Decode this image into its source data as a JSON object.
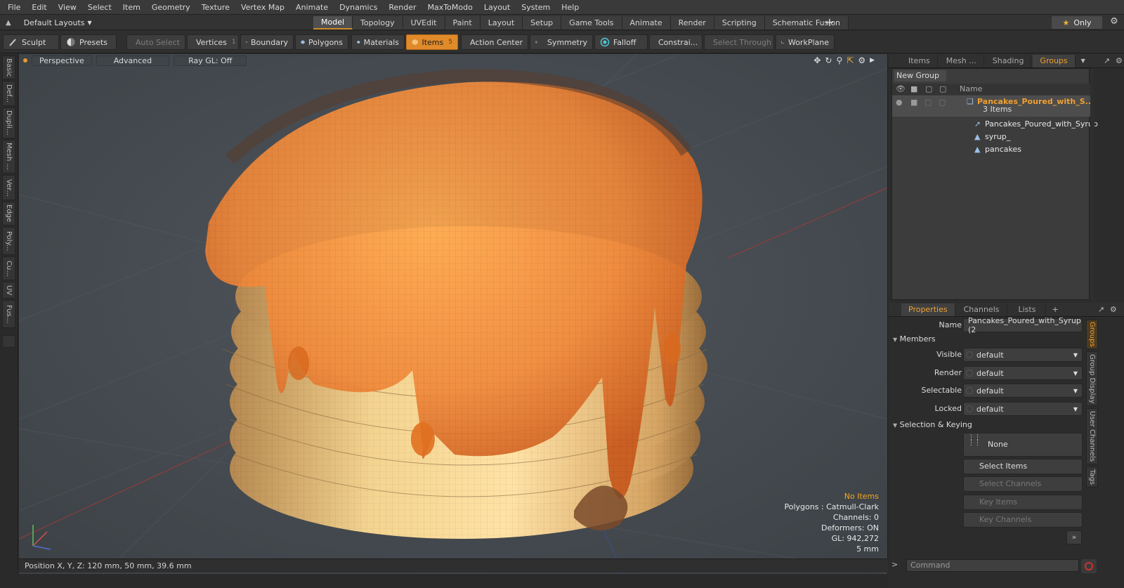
{
  "menu": [
    "File",
    "Edit",
    "View",
    "Select",
    "Item",
    "Geometry",
    "Texture",
    "Vertex Map",
    "Animate",
    "Dynamics",
    "Render",
    "MaxToModo",
    "Layout",
    "System",
    "Help"
  ],
  "layout": {
    "label": "Default Layouts"
  },
  "mode_tabs": [
    "Model",
    "Topology",
    "UVEdit",
    "Paint",
    "Layout",
    "Setup",
    "Game Tools",
    "Animate",
    "Render",
    "Scripting",
    "Schematic Fusion"
  ],
  "only_label": "Only",
  "toolbar": {
    "sculpt": "Sculpt",
    "presets": "Presets",
    "auto_select": "Auto Select",
    "vertices": "Vertices",
    "vertices_count": "1",
    "boundary": "Boundary",
    "polygons": "Polygons",
    "materials": "Materials",
    "items": "Items",
    "items_count": "5",
    "action_center": "Action Center",
    "symmetry": "Symmetry",
    "falloff": "Falloff",
    "constraints": "Constrai...",
    "select_through": "Select Through",
    "workplane": "WorkPlane"
  },
  "left_tabs": [
    "Basic",
    "Def...",
    "Dupli...",
    "Mesh ...",
    "Ver...",
    "Edge",
    "Poly...",
    "Cu...",
    "UV",
    "Fus..."
  ],
  "viewport": {
    "view": "Perspective",
    "shading": "Advanced",
    "raygl": "Ray GL: Off",
    "info": {
      "selection": "No Items",
      "polygons": "Polygons : Catmull-Clark",
      "channels": "Channels: 0",
      "deformers": "Deformers: ON",
      "gl": "GL: 942,272",
      "scale": "5 mm"
    }
  },
  "status": {
    "position": "Position X, Y, Z:   120 mm, 50 mm, 39.6 mm"
  },
  "right_top": {
    "tabs": [
      "Items",
      "Mesh ...",
      "Shading",
      "Groups"
    ],
    "new_group": "New Group",
    "column_name": "Name",
    "group_name": "Pancakes_Poured_with_S...",
    "group_count": "3 Items",
    "children": [
      "Pancakes_Poured_with_Syrup",
      "syrup_",
      "pancakes"
    ]
  },
  "properties": {
    "tabs": [
      "Properties",
      "Channels",
      "Lists"
    ],
    "name_label": "Name",
    "name_value": "Pancakes_Poured_with_Syrup (2",
    "members_section": "Members",
    "rows": [
      {
        "label": "Visible",
        "value": "default"
      },
      {
        "label": "Render",
        "value": "default"
      },
      {
        "label": "Selectable",
        "value": "default"
      },
      {
        "label": "Locked",
        "value": "default"
      }
    ],
    "sel_section": "Selection & Keying",
    "none_label": "None",
    "buttons": [
      "Select Items",
      "Select Channels",
      "Key Items",
      "Key Channels"
    ],
    "side_tabs": [
      "Groups",
      "Group Display",
      "User Channels",
      "Tags"
    ]
  },
  "command": {
    "placeholder": "Command"
  }
}
